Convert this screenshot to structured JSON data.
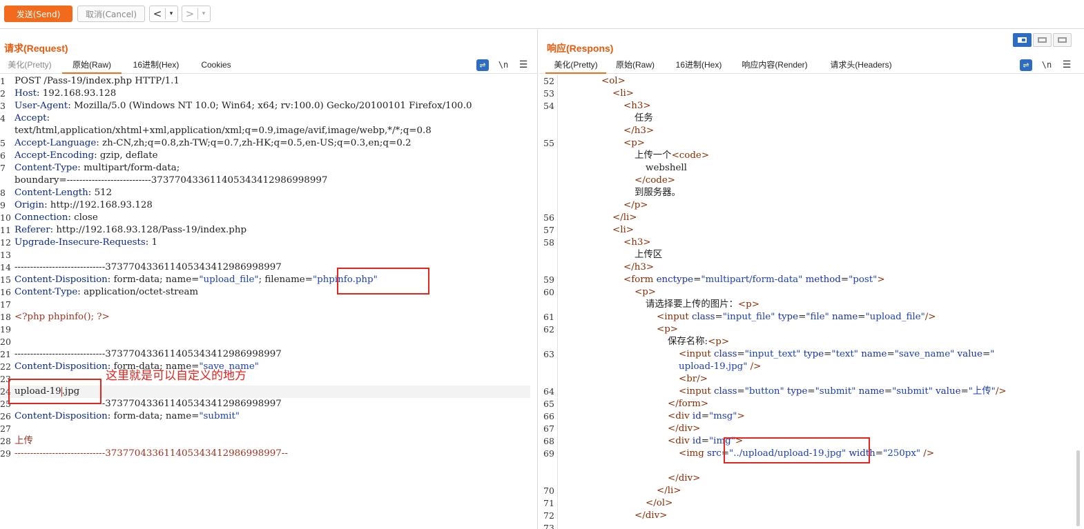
{
  "toolbar": {
    "send_label": "发送(Send)",
    "cancel_label": "取消(Cancel)",
    "back_glyph": "<",
    "forward_glyph": ">",
    "dropdown_glyph": "▾"
  },
  "request": {
    "title": "请求(Request)",
    "tabs": [
      "美化(Pretty)",
      "原始(Raw)",
      "16进制(Hex)",
      "Cookies"
    ],
    "active_tab": "原始(Raw)",
    "newline_toggle": "\\n",
    "annotation": "这里就是可以自定义的地方",
    "lines": [
      {
        "n": "1",
        "parts": [
          [
            "v",
            "POST /Pass-19/index.php HTTP/1.1"
          ]
        ]
      },
      {
        "n": "2",
        "parts": [
          [
            "k",
            "Host"
          ],
          [
            "v",
            ": 192.168.93.128"
          ]
        ]
      },
      {
        "n": "3",
        "parts": [
          [
            "k",
            "User-Agent"
          ],
          [
            "v",
            ": Mozilla/5.0 (Windows NT 10.0; Win64; x64; rv:100.0) Gecko/20100101 Firefox/100.0"
          ]
        ]
      },
      {
        "n": "4",
        "parts": [
          [
            "k",
            "Accept"
          ],
          [
            "v",
            ":"
          ]
        ]
      },
      {
        "n": "",
        "parts": [
          [
            "v",
            "text/html,application/xhtml+xml,application/xml;q=0.9,image/avif,image/webp,*/*;q=0.8"
          ]
        ]
      },
      {
        "n": "5",
        "parts": [
          [
            "k",
            "Accept-Language"
          ],
          [
            "v",
            ": zh-CN,zh;q=0.8,zh-TW;q=0.7,zh-HK;q=0.5,en-US;q=0.3,en;q=0.2"
          ]
        ]
      },
      {
        "n": "6",
        "parts": [
          [
            "k",
            "Accept-Encoding"
          ],
          [
            "v",
            ": gzip, deflate"
          ]
        ]
      },
      {
        "n": "7",
        "parts": [
          [
            "k",
            "Content-Type"
          ],
          [
            "v",
            ": multipart/form-data;"
          ]
        ]
      },
      {
        "n": "",
        "parts": [
          [
            "v",
            "boundary=---------------------------373770433611405343412986998997"
          ]
        ]
      },
      {
        "n": "8",
        "parts": [
          [
            "k",
            "Content-Length"
          ],
          [
            "v",
            ": 512"
          ]
        ]
      },
      {
        "n": "9",
        "parts": [
          [
            "k",
            "Origin"
          ],
          [
            "v",
            ": http://192.168.93.128"
          ]
        ]
      },
      {
        "n": "10",
        "parts": [
          [
            "k",
            "Connection"
          ],
          [
            "v",
            ": close"
          ]
        ]
      },
      {
        "n": "11",
        "parts": [
          [
            "k",
            "Referer"
          ],
          [
            "v",
            ": http://192.168.93.128/Pass-19/index.php"
          ]
        ]
      },
      {
        "n": "12",
        "parts": [
          [
            "k",
            "Upgrade-Insecure-Requests"
          ],
          [
            "v",
            ": 1"
          ]
        ]
      },
      {
        "n": "13",
        "parts": []
      },
      {
        "n": "14",
        "parts": [
          [
            "v",
            "-----------------------------373770433611405343412986998997"
          ]
        ]
      },
      {
        "n": "15",
        "parts": [
          [
            "k",
            "Content-Disposition"
          ],
          [
            "v",
            ": form-data; name="
          ],
          [
            "s",
            "\"upload_file\""
          ],
          [
            "v",
            "; filename="
          ],
          [
            "s",
            "\"phpinfo.php\""
          ]
        ]
      },
      {
        "n": "16",
        "parts": [
          [
            "k",
            "Content-Type"
          ],
          [
            "v",
            ": application/octet-stream"
          ]
        ]
      },
      {
        "n": "17",
        "parts": []
      },
      {
        "n": "18",
        "parts": [
          [
            "r",
            "<?php phpinfo(); ?>"
          ]
        ]
      },
      {
        "n": "19",
        "parts": []
      },
      {
        "n": "20",
        "parts": []
      },
      {
        "n": "21",
        "parts": [
          [
            "v",
            "-----------------------------373770433611405343412986998997"
          ]
        ]
      },
      {
        "n": "22",
        "parts": [
          [
            "k",
            "Content-Disposition"
          ],
          [
            "v",
            ": form-data; name="
          ],
          [
            "s",
            "\"save_name\""
          ]
        ]
      },
      {
        "n": "23",
        "parts": []
      },
      {
        "n": "24",
        "parts": [
          [
            "v",
            "upload-19.jpg"
          ]
        ]
      },
      {
        "n": "25",
        "parts": [
          [
            "v",
            "-----------------------------373770433611405343412986998997"
          ]
        ]
      },
      {
        "n": "26",
        "parts": [
          [
            "k",
            "Content-Disposition"
          ],
          [
            "v",
            ": form-data; name="
          ],
          [
            "s",
            "\"submit\""
          ]
        ]
      },
      {
        "n": "27",
        "parts": []
      },
      {
        "n": "28",
        "parts": [
          [
            "r",
            "上传"
          ]
        ]
      },
      {
        "n": "29",
        "parts": [
          [
            "r",
            "-----------------------------373770433611405343412986998997--"
          ]
        ]
      }
    ]
  },
  "response": {
    "title": "响应(Respons)",
    "tabs": [
      "美化(Pretty)",
      "原始(Raw)",
      "16进制(Hex)",
      "响应内容(Render)",
      "请求头(Headers)"
    ],
    "active_tab": "美化(Pretty)",
    "newline_toggle": "\\n",
    "lines": [
      {
        "n": "52",
        "indent": 6,
        "parts": [
          [
            "t",
            "<ol>"
          ]
        ]
      },
      {
        "n": "53",
        "indent": 7,
        "parts": [
          [
            "t",
            "<li>"
          ]
        ]
      },
      {
        "n": "54",
        "indent": 8,
        "parts": [
          [
            "t",
            "<h3>"
          ]
        ]
      },
      {
        "n": "",
        "indent": 9,
        "parts": [
          [
            "v",
            "任务"
          ]
        ]
      },
      {
        "n": "",
        "indent": 8,
        "parts": [
          [
            "t",
            "</h3>"
          ]
        ]
      },
      {
        "n": "55",
        "indent": 8,
        "parts": [
          [
            "t",
            "<p>"
          ]
        ]
      },
      {
        "n": "",
        "indent": 9,
        "parts": [
          [
            "v",
            "上传一个"
          ],
          [
            "t",
            "<code>"
          ]
        ]
      },
      {
        "n": "",
        "indent": 10,
        "parts": [
          [
            "v",
            "webshell"
          ]
        ]
      },
      {
        "n": "",
        "indent": 9,
        "parts": [
          [
            "t",
            "</code>"
          ]
        ]
      },
      {
        "n": "",
        "indent": 9,
        "parts": [
          [
            "v",
            "到服务器。"
          ]
        ]
      },
      {
        "n": "",
        "indent": 8,
        "parts": [
          [
            "t",
            "</p>"
          ]
        ]
      },
      {
        "n": "56",
        "indent": 7,
        "parts": [
          [
            "t",
            "</li>"
          ]
        ]
      },
      {
        "n": "57",
        "indent": 7,
        "parts": [
          [
            "t",
            "<li>"
          ]
        ]
      },
      {
        "n": "58",
        "indent": 8,
        "parts": [
          [
            "t",
            "<h3>"
          ]
        ]
      },
      {
        "n": "",
        "indent": 9,
        "parts": [
          [
            "v",
            "上传区"
          ]
        ]
      },
      {
        "n": "",
        "indent": 8,
        "parts": [
          [
            "t",
            "</h3>"
          ]
        ]
      },
      {
        "n": "59",
        "indent": 8,
        "parts": [
          [
            "t",
            "<form "
          ],
          [
            "a",
            "enctype"
          ],
          [
            "v",
            "="
          ],
          [
            "sv",
            "\"multipart/form-data\""
          ],
          [
            "a",
            " method"
          ],
          [
            "v",
            "="
          ],
          [
            "sv",
            "\"post\""
          ],
          [
            "t",
            ">"
          ]
        ]
      },
      {
        "n": "60",
        "indent": 9,
        "parts": [
          [
            "t",
            "<p>"
          ]
        ]
      },
      {
        "n": "",
        "indent": 10,
        "parts": [
          [
            "v",
            "请选择要上传的图片："
          ],
          [
            "t",
            "<p>"
          ]
        ]
      },
      {
        "n": "61",
        "indent": 11,
        "parts": [
          [
            "t",
            "<input "
          ],
          [
            "a",
            "class"
          ],
          [
            "v",
            "="
          ],
          [
            "sv",
            "\"input_file\""
          ],
          [
            "a",
            " type"
          ],
          [
            "v",
            "="
          ],
          [
            "sv",
            "\"file\""
          ],
          [
            "a",
            " name"
          ],
          [
            "v",
            "="
          ],
          [
            "sv",
            "\"upload_file\""
          ],
          [
            "t",
            "/>"
          ]
        ]
      },
      {
        "n": "62",
        "indent": 11,
        "parts": [
          [
            "t",
            "<p>"
          ]
        ]
      },
      {
        "n": "",
        "indent": 12,
        "parts": [
          [
            "v",
            "保存名称:"
          ],
          [
            "t",
            "<p>"
          ]
        ]
      },
      {
        "n": "63",
        "indent": 13,
        "parts": [
          [
            "t",
            "<input "
          ],
          [
            "a",
            "class"
          ],
          [
            "v",
            "="
          ],
          [
            "sv",
            "\"input_text\""
          ],
          [
            "a",
            " type"
          ],
          [
            "v",
            "="
          ],
          [
            "sv",
            "\"text\""
          ],
          [
            "a",
            " name"
          ],
          [
            "v",
            "="
          ],
          [
            "sv",
            "\"save_name\""
          ],
          [
            "a",
            " value"
          ],
          [
            "v",
            "="
          ],
          [
            "sv",
            "\""
          ]
        ]
      },
      {
        "n": "",
        "indent": 13,
        "parts": [
          [
            "sv",
            "upload-19.jpg\""
          ],
          [
            "t",
            " />"
          ]
        ]
      },
      {
        "n": "",
        "indent": 13,
        "parts": [
          [
            "t",
            "<br/>"
          ]
        ]
      },
      {
        "n": "64",
        "indent": 13,
        "parts": [
          [
            "t",
            "<input "
          ],
          [
            "a",
            "class"
          ],
          [
            "v",
            "="
          ],
          [
            "sv",
            "\"button\""
          ],
          [
            "a",
            " type"
          ],
          [
            "v",
            "="
          ],
          [
            "sv",
            "\"submit\""
          ],
          [
            "a",
            " name"
          ],
          [
            "v",
            "="
          ],
          [
            "sv",
            "\"submit\""
          ],
          [
            "a",
            " value"
          ],
          [
            "v",
            "="
          ],
          [
            "sv",
            "\"上传\""
          ],
          [
            "t",
            "/>"
          ]
        ]
      },
      {
        "n": "65",
        "indent": 12,
        "parts": [
          [
            "t",
            "</form>"
          ]
        ]
      },
      {
        "n": "66",
        "indent": 12,
        "parts": [
          [
            "t",
            "<div "
          ],
          [
            "a",
            "id"
          ],
          [
            "v",
            "="
          ],
          [
            "sv",
            "\"msg\""
          ],
          [
            "t",
            ">"
          ]
        ]
      },
      {
        "n": "67",
        "indent": 12,
        "parts": [
          [
            "t",
            "</div>"
          ]
        ]
      },
      {
        "n": "68",
        "indent": 12,
        "parts": [
          [
            "t",
            "<div "
          ],
          [
            "a",
            "id"
          ],
          [
            "v",
            "="
          ],
          [
            "sv",
            "\"img\""
          ],
          [
            "t",
            ">"
          ]
        ]
      },
      {
        "n": "69",
        "indent": 13,
        "parts": [
          [
            "t",
            "<img "
          ],
          [
            "a",
            "src"
          ],
          [
            "v",
            "="
          ],
          [
            "sv",
            "\"../upload/upload-19.jpg\""
          ],
          [
            "a",
            " width"
          ],
          [
            "v",
            "="
          ],
          [
            "sv",
            "\"250px\""
          ],
          [
            "t",
            " />"
          ]
        ]
      },
      {
        "n": "",
        "indent": 0,
        "parts": []
      },
      {
        "n": "",
        "indent": 12,
        "parts": [
          [
            "t",
            "</div>"
          ]
        ]
      },
      {
        "n": "70",
        "indent": 11,
        "parts": [
          [
            "t",
            "</li>"
          ]
        ]
      },
      {
        "n": "71",
        "indent": 10,
        "parts": [
          [
            "t",
            "</ol>"
          ]
        ]
      },
      {
        "n": "72",
        "indent": 9,
        "parts": [
          [
            "t",
            "</div>"
          ]
        ]
      },
      {
        "n": "73",
        "indent": 0,
        "parts": []
      }
    ]
  },
  "colors": {
    "send": "#f26b1d",
    "title": "#e8590c",
    "highlight_box": "#e5241e",
    "header_key": "#0b2a88",
    "string": "#1a3fb5",
    "tag": "#8a2a00"
  }
}
